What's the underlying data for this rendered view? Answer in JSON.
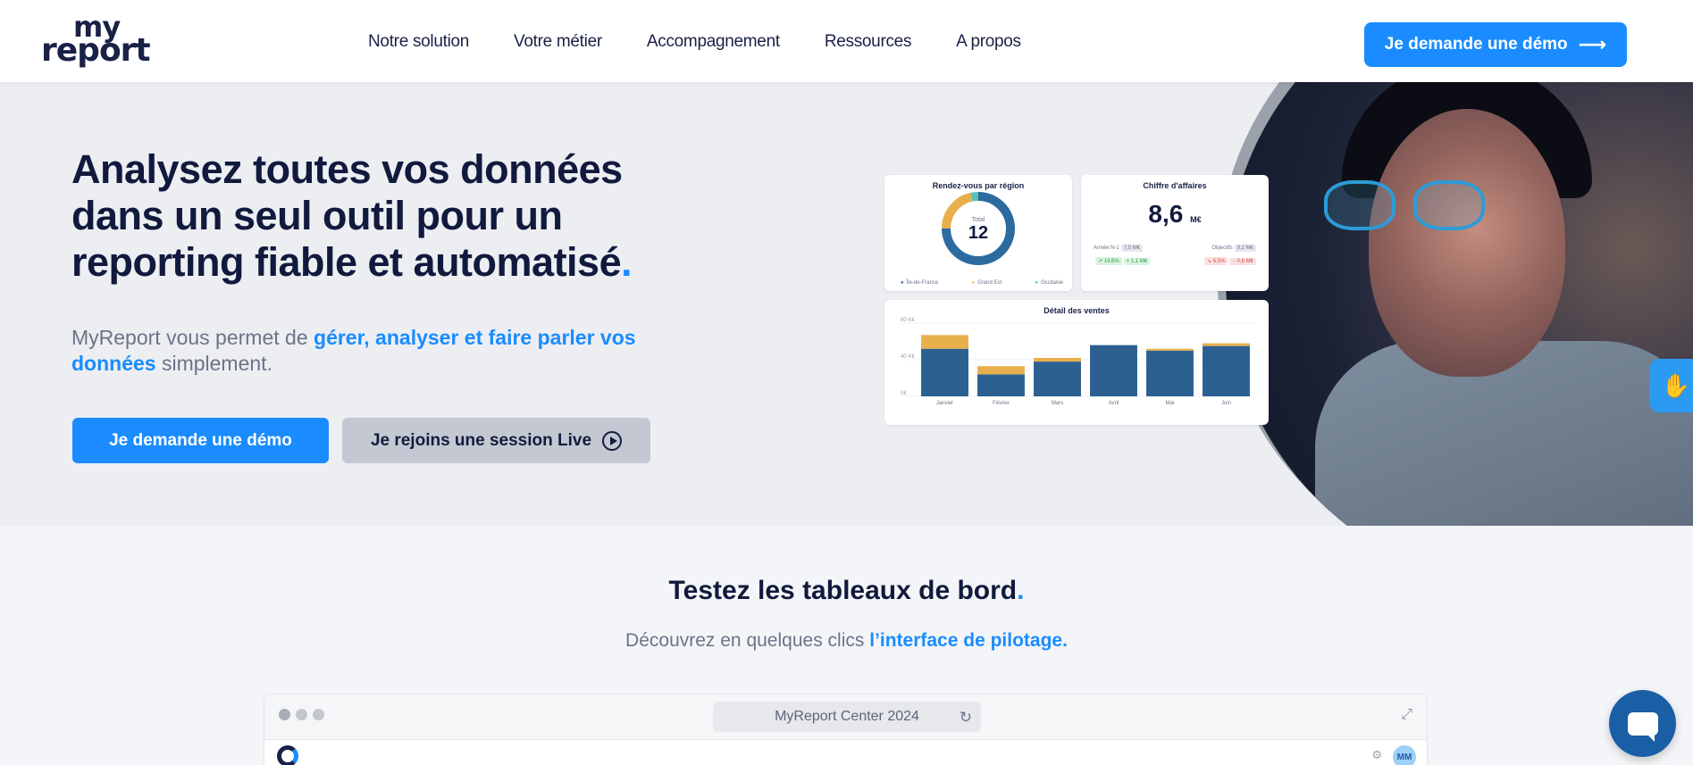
{
  "brand": {
    "logo_line1": "my",
    "logo_line2": "report",
    "accent": "#1a8cff",
    "navy": "#111a3d"
  },
  "nav": {
    "items": [
      "Notre solution",
      "Votre métier",
      "Accompagnement",
      "Ressources",
      "A propos"
    ]
  },
  "header_cta": {
    "label": "Je demande une démo",
    "icon": "arrow-right-icon"
  },
  "hero": {
    "title": "Analysez toutes vos données dans un seul outil pour un reporting fiable et automatisé",
    "title_dot": ".",
    "sub_before": "MyReport vous permet de ",
    "sub_highlight": "gérer, analyser et faire parler vos données",
    "sub_after": " simplement.",
    "btn_demo": "Je demande une démo",
    "btn_live": "Je rejoins une session Live",
    "btn_live_icon": "play-circle-icon"
  },
  "dashboard": {
    "donut_card": {
      "title": "Rendez-vous par région",
      "center_label": "Total",
      "center_value": "12",
      "legend": [
        "Île-de-France",
        "Grand Est",
        "Occitanie"
      ]
    },
    "kpi_card": {
      "title": "Chiffre d'affaires",
      "value": "8,6",
      "unit": "M€",
      "row1_left_label": "Année N-1",
      "row1_left_value": "7,5 M€",
      "row1_right_label": "Objectifs",
      "row1_right_value": "9,2 M€",
      "row2_left_a": "↗ 14,6%",
      "row2_left_b": "+ 1,1 M€",
      "row2_right_a": "↘ 6,5%",
      "row2_right_b": "− 0,6 M€"
    }
  },
  "chart_data": [
    {
      "type": "pie",
      "title": "Rendez-vous par région",
      "categories": [
        "Île-de-France",
        "Grand Est",
        "Occitanie"
      ],
      "values": [
        9,
        2.6,
        0.4
      ],
      "colors": [
        "#2c6ba0",
        "#e8b04c",
        "#58c2b5"
      ]
    },
    {
      "type": "bar",
      "title": "Détail des ventes",
      "categories": [
        "Janvier",
        "Février",
        "Mars",
        "Avril",
        "Mai",
        "Juin"
      ],
      "series": [
        {
          "values": [
            52,
            24,
            38,
            56,
            50,
            55
          ],
          "color": "#2c6091"
        },
        {
          "values": [
            15,
            9,
            4,
            0,
            2,
            3
          ],
          "color": "#e8b04c"
        }
      ],
      "yticks": [
        "80 K€",
        "40 K€",
        "0€"
      ],
      "ylim": [
        0,
        80
      ]
    }
  ],
  "section2": {
    "title": "Testez les tableaux de bord",
    "title_dot": ".",
    "sub_before": "Découvrez en quelques clics ",
    "sub_highlight": "l’interface de pilotage."
  },
  "browser": {
    "url_label": "MyReport Center 2024",
    "avatar_initials": "MM"
  }
}
